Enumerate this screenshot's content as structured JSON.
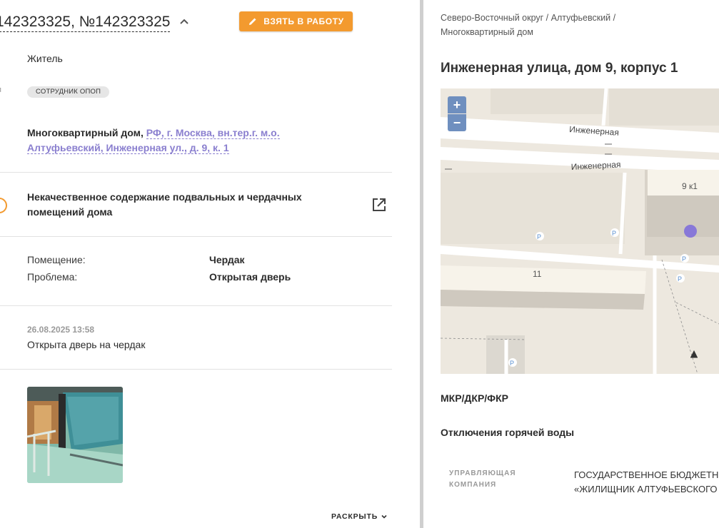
{
  "ticket": {
    "title": "142323325, №142323325",
    "take_button": "ВЗЯТЬ В РАБОТУ",
    "role": "Житель",
    "cut_label": "я",
    "badge": "СОТРУДНИК ОПОП",
    "address_prefix": "Многоквартирный дом,",
    "address_link": "РФ, г. Москва, вн.тер.г. м.о. Алтуфьевский, Инженерная ул., д. 9, к. 1",
    "issue": "Некачественное содержание подвальных и чердачных помещений дома",
    "details": [
      {
        "label": "Помещение:",
        "value": "Чердак"
      },
      {
        "label": "Проблема:",
        "value": "Открытая дверь"
      }
    ],
    "date": "26.08.2025 13:58",
    "comment": "Открыта дверь на чердак",
    "expand": "РАСКРЫТЬ"
  },
  "building": {
    "breadcrumb_line1": "Северо-Восточный округ / Алтуфьевский /",
    "breadcrumb_line2": "Многоквартирный дом",
    "title": "Инженерная улица, дом 9, корпус 1",
    "map": {
      "zoom_in": "+",
      "zoom_out": "−",
      "street_label_1": "Инженерная",
      "street_label_2": "Инженерная",
      "house_label_1": "9 к1",
      "house_label_2": "11",
      "parking": "P",
      "marker_color": "#8878d8"
    },
    "section_1": "МКР/ДКР/ФКР",
    "section_2": "Отключения горячей воды",
    "uk_label": "УПРАВЛЯЮЩАЯ КОМПАНИЯ",
    "uk_value_line1": "ГОСУДАРСТВЕННОЕ БЮДЖЕТН",
    "uk_value_line2": "«ЖИЛИЩНИК АЛТУФЬЕВСКОГО"
  },
  "colors": {
    "accent": "#f39a2f",
    "link": "#8a7fcf",
    "zoom": "#6f8fbf"
  }
}
